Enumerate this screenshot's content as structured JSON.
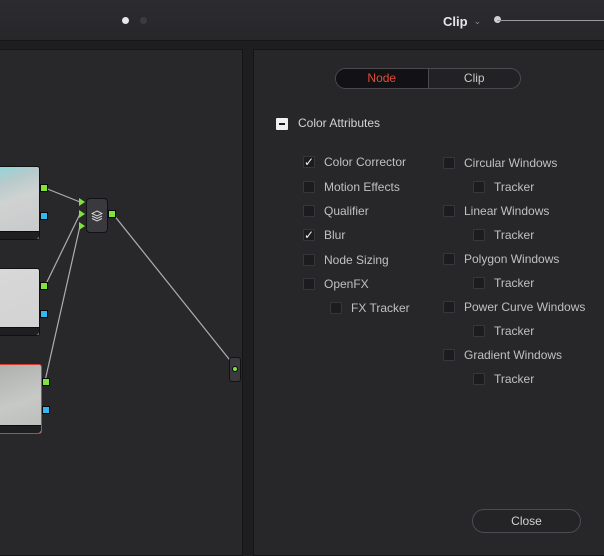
{
  "header": {
    "page_dots": [
      "page-1",
      "page-2"
    ],
    "clip_dropdown_value": "Clip",
    "clip_dropdown_icon": "chevron-down-icon"
  },
  "node_editor": {
    "nodes": [
      "node-1",
      "node-2",
      "node-3"
    ],
    "layer_mixer_icon": "layers-icon",
    "colors": {
      "green_pin": "#7ee33a",
      "blue_pin": "#35b6ef",
      "selected_outline": "#d83c30"
    }
  },
  "settings": {
    "mode_tabs": [
      {
        "label": "Node",
        "active": true
      },
      {
        "label": "Clip",
        "active": false
      }
    ],
    "section_title": "Color Attributes",
    "left_column": [
      {
        "label": "Color Corrector",
        "checked": true
      },
      {
        "label": "Motion Effects",
        "checked": false
      },
      {
        "label": "Qualifier",
        "checked": false
      },
      {
        "label": "Blur",
        "checked": true
      },
      {
        "label": "Node Sizing",
        "checked": false
      },
      {
        "label": "OpenFX",
        "checked": false
      },
      {
        "label": "FX Tracker",
        "checked": false
      }
    ],
    "right_column": [
      {
        "label": "Circular Windows",
        "checked": false
      },
      {
        "label": "Tracker",
        "checked": false
      },
      {
        "label": "Linear Windows",
        "checked": false
      },
      {
        "label": "Tracker",
        "checked": false
      },
      {
        "label": "Polygon Windows",
        "checked": false
      },
      {
        "label": "Tracker",
        "checked": false
      },
      {
        "label": "Power Curve Windows",
        "checked": false
      },
      {
        "label": "Tracker",
        "checked": false
      },
      {
        "label": "Gradient Windows",
        "checked": false
      },
      {
        "label": "Tracker",
        "checked": false
      }
    ],
    "close_label": "Close",
    "accent_color": "#e24a3a"
  }
}
